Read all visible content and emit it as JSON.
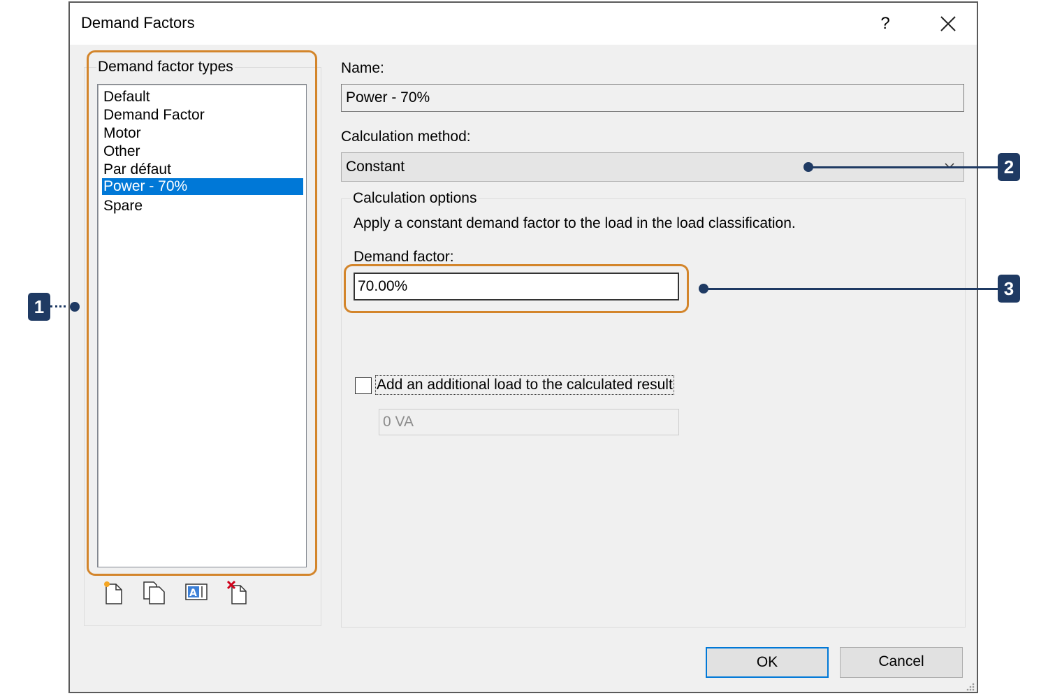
{
  "dialog": {
    "title": "Demand Factors",
    "help_label": "?",
    "close_icon": "close-icon"
  },
  "left": {
    "group_label": "Demand factor types",
    "items": [
      {
        "label": "Default",
        "selected": false
      },
      {
        "label": "Demand Factor",
        "selected": false
      },
      {
        "label": "Motor",
        "selected": false
      },
      {
        "label": "Other",
        "selected": false
      },
      {
        "label": "Par défaut",
        "selected": false
      },
      {
        "label": "Power - 70%",
        "selected": true
      },
      {
        "label": "Spare",
        "selected": false
      }
    ],
    "toolbar_icons": [
      "new-type-icon",
      "duplicate-type-icon",
      "rename-type-icon",
      "delete-type-icon"
    ]
  },
  "right": {
    "name_label": "Name:",
    "name_value": "Power - 70%",
    "method_label": "Calculation method:",
    "method_value": "Constant",
    "options_label": "Calculation options",
    "description": "Apply a constant demand factor to the load in the load classification.",
    "demand_factor_label": "Demand factor:",
    "demand_factor_value": "70.00%",
    "additional_load_label": "Add an additional load to the calculated result",
    "additional_load_checked": false,
    "additional_load_value": "0 VA"
  },
  "buttons": {
    "ok": "OK",
    "cancel": "Cancel"
  },
  "callouts": {
    "one": "1",
    "two": "2",
    "three": "3"
  },
  "colors": {
    "highlight": "#d3852b",
    "callout": "#1f3a63",
    "selection": "#0078d7"
  }
}
